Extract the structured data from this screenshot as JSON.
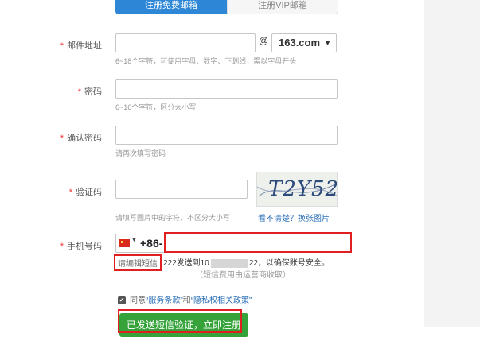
{
  "tabs": {
    "free": "注册免费邮箱",
    "vip": "注册VIP邮箱"
  },
  "email": {
    "label": "邮件地址",
    "at": "@",
    "domain": "163.com",
    "hint": "6~18个字符，可使用字母、数字、下划线，需以字母开头"
  },
  "password": {
    "label": "密码",
    "hint": "6~16个字符，区分大小写"
  },
  "confirm": {
    "label": "确认密码",
    "hint": "请再次填写密码"
  },
  "captcha": {
    "label": "验证码",
    "hint": "请填写图片中的字符，不区分大小写",
    "image_text": "T2Y52",
    "refresh": "看不清楚？换张图片"
  },
  "phone": {
    "label": "手机号码",
    "code": "+86-",
    "sms_edit": "请编辑短信",
    "sms_text_a": "222发送到10",
    "sms_text_b": "22，以确保账号安全。",
    "sms_sub": "（短信费用由运营商收取）"
  },
  "agreement": {
    "prefix": "同意",
    "terms": "“服务条款”",
    "and": "和",
    "privacy": "“隐私权相关政策”"
  },
  "submit": "已发送短信验证，立即注册",
  "required": "*",
  "checkmark": "✔"
}
